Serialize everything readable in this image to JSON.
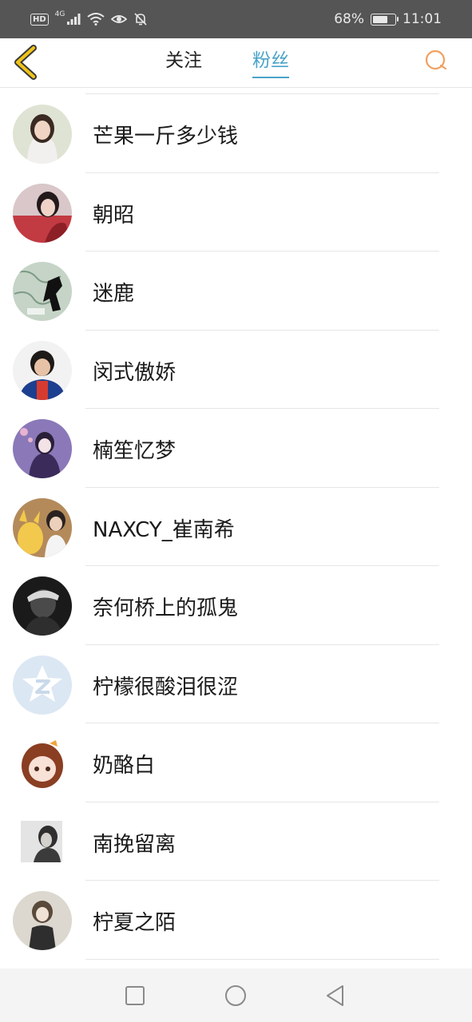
{
  "status_bar": {
    "hd": "HD",
    "network": "4G",
    "battery_percent_text": "68%",
    "battery_level": 0.68,
    "time": "11:01",
    "icons": [
      "signal-icon",
      "wifi-icon",
      "eye-icon",
      "mute-bell-icon",
      "battery-icon"
    ]
  },
  "header": {
    "back_icon": "chevron-left-icon",
    "tabs": [
      {
        "label": "关注",
        "active": false
      },
      {
        "label": "粉丝",
        "active": true
      }
    ],
    "search_icon": "search-icon",
    "accent_color": "#4aa3c8",
    "back_color": "#f0c419",
    "search_color": "#f0a060"
  },
  "fans": [
    {
      "name": "芒果一斤多少钱",
      "avatar": "avatar-girl-photo"
    },
    {
      "name": "朝昭",
      "avatar": "avatar-red-costume"
    },
    {
      "name": "迷鹿",
      "avatar": "avatar-map-silhouette"
    },
    {
      "name": "闵式傲娇",
      "avatar": "avatar-boy-photo"
    },
    {
      "name": "楠笙忆梦",
      "avatar": "avatar-purple-illustration"
    },
    {
      "name": "NAXCY_崔南希",
      "avatar": "avatar-pikachu-photo"
    },
    {
      "name": "奈何桥上的孤鬼",
      "avatar": "avatar-dark-photo"
    },
    {
      "name": "柠檬很酸泪很涩",
      "avatar": "avatar-default-qzone"
    },
    {
      "name": "奶酪白",
      "avatar": "avatar-anime-girl"
    },
    {
      "name": "南挽留离",
      "avatar": "avatar-grey-photo"
    },
    {
      "name": "柠夏之陌",
      "avatar": "avatar-figure-illustration"
    }
  ],
  "nav_bar": {
    "icons": [
      "recent-apps-icon",
      "home-icon",
      "back-triangle-icon"
    ]
  }
}
